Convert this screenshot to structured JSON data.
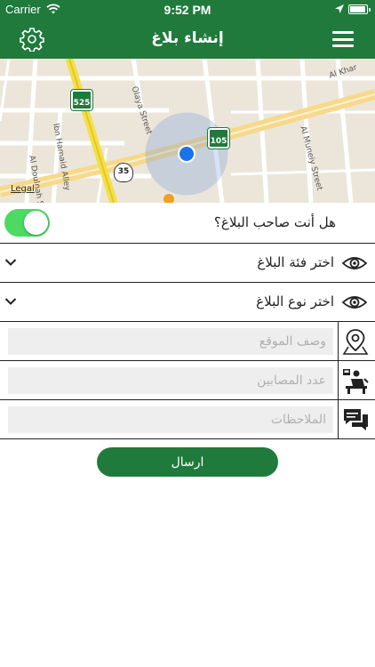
{
  "status_bar": {
    "carrier": "Carrier",
    "time": "9:52 PM"
  },
  "header": {
    "title": "إنشاء بلاغ",
    "left_icon": "gear-icon",
    "right_icon": "hamburger-menu-icon"
  },
  "map": {
    "street_labels": [
      "Olaya Street",
      "Al Khar",
      "Al Muneiy Street",
      "Ibn Hamaid Alley",
      "Al Doulnah Street",
      "Legal"
    ],
    "route_shields": [
      "525",
      "105",
      "35"
    ],
    "current_location_color": "#1a73e8"
  },
  "owner_question": {
    "label": "هل أنت صاحب البلاغ؟",
    "switch_on": true
  },
  "category_select": {
    "label": "اختر فئة البلاغ",
    "icon": "eye-icon"
  },
  "type_select": {
    "label": "اختر نوع البلاغ",
    "icon": "eye-icon"
  },
  "location_field": {
    "placeholder": "وصف الموقع",
    "value": "",
    "icon": "map-pin-icon"
  },
  "injured_field": {
    "placeholder": "عدد المصابين",
    "value": "",
    "icon": "injured-person-icon"
  },
  "notes_field": {
    "placeholder": "الملاحظات",
    "value": "",
    "icon": "chat-bubbles-icon"
  },
  "submit": {
    "label": "ارسال"
  },
  "colors": {
    "primary": "#1f7a3c",
    "switch_on": "#4cd964",
    "input_bg": "#eeeeee"
  }
}
